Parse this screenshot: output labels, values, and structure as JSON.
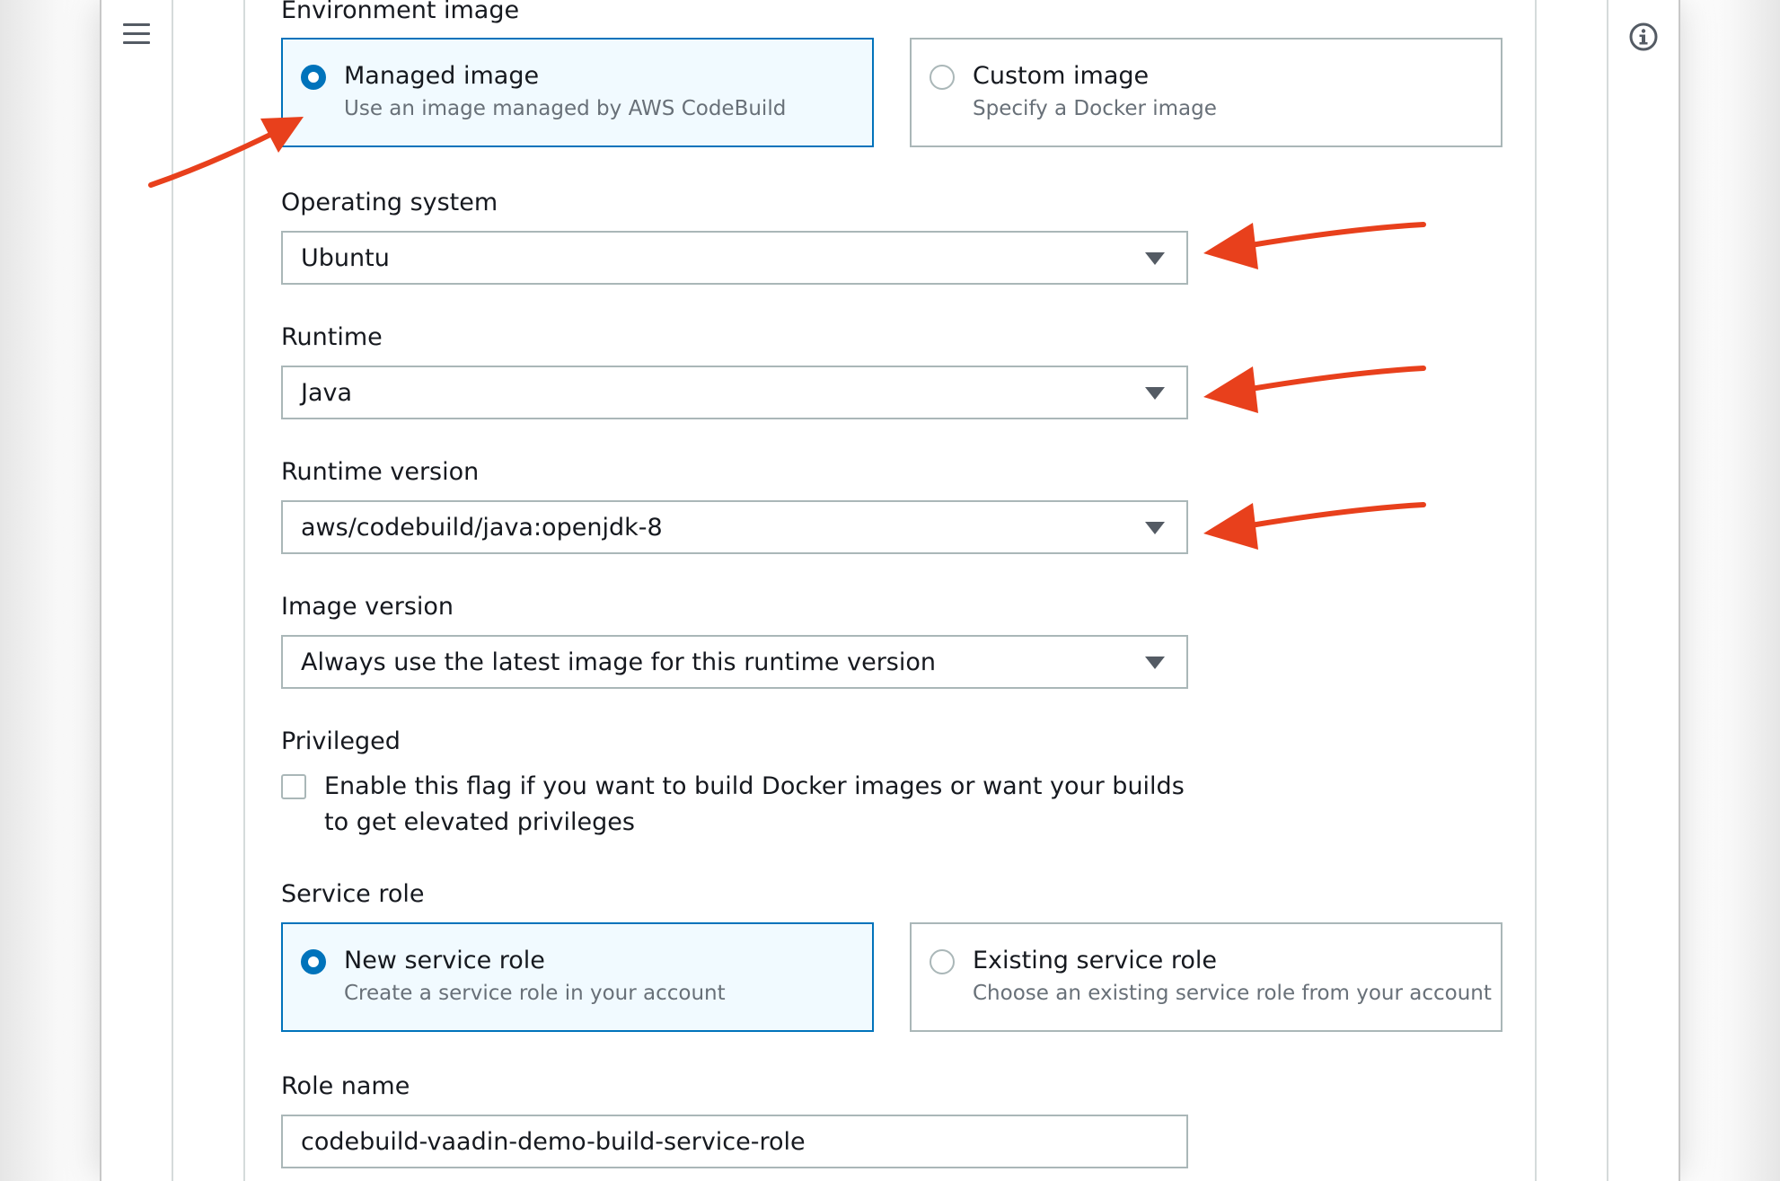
{
  "environment_image": {
    "label": "Environment image",
    "options": [
      {
        "title": "Managed image",
        "description": "Use an image managed by AWS CodeBuild",
        "selected": true
      },
      {
        "title": "Custom image",
        "description": "Specify a Docker image",
        "selected": false
      }
    ]
  },
  "operating_system": {
    "label": "Operating system",
    "value": "Ubuntu"
  },
  "runtime": {
    "label": "Runtime",
    "value": "Java"
  },
  "runtime_version": {
    "label": "Runtime version",
    "value": "aws/codebuild/java:openjdk-8"
  },
  "image_version": {
    "label": "Image version",
    "value": "Always use the latest image for this runtime version"
  },
  "privileged": {
    "label": "Privileged",
    "checkbox_text": "Enable this flag if you want to build Docker images or want your builds to get elevated privileges",
    "checked": false
  },
  "service_role": {
    "label": "Service role",
    "options": [
      {
        "title": "New service role",
        "description": "Create a service role in your account",
        "selected": true
      },
      {
        "title": "Existing service role",
        "description": "Choose an existing service role from your account",
        "selected": false
      }
    ]
  },
  "role_name": {
    "label": "Role name",
    "value": "codebuild-vaadin-demo-build-service-role"
  },
  "icons": {
    "menu": "hamburger-menu-icon",
    "info": "info-icon",
    "annotation": "red-arrow-annotation"
  },
  "colors": {
    "selected_border": "#0073bb",
    "selected_bg": "#f1faff",
    "annotation": "#e8401c"
  }
}
